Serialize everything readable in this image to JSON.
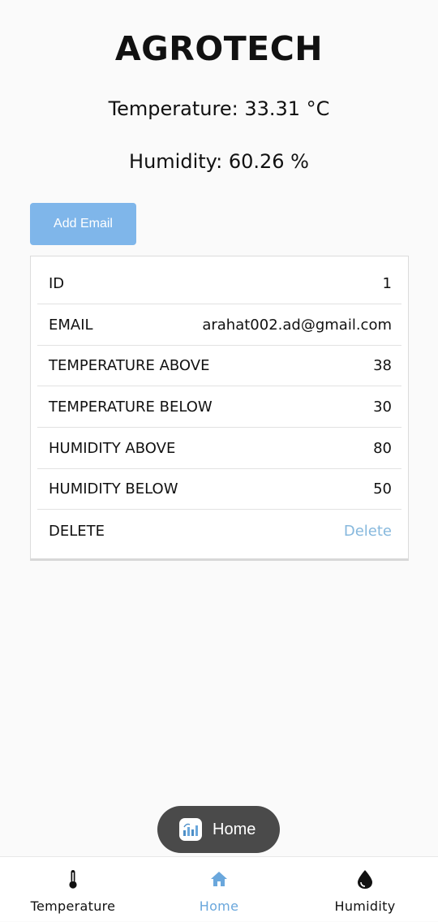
{
  "app": {
    "title": "AGROTECH",
    "temperature_reading": "Temperature: 33.31 °C",
    "humidity_reading": "Humidity: 60.26 %"
  },
  "actions": {
    "add_email_label": "Add Email"
  },
  "record": {
    "rows": [
      {
        "label": "ID",
        "value": "1"
      },
      {
        "label": "EMAIL",
        "value": "arahat002.ad@gmail.com"
      },
      {
        "label": "TEMPERATURE ABOVE",
        "value": "38"
      },
      {
        "label": "TEMPERATURE BELOW",
        "value": "30"
      },
      {
        "label": "HUMIDITY ABOVE",
        "value": "80"
      },
      {
        "label": "HUMIDITY BELOW",
        "value": "50"
      },
      {
        "label": "DELETE",
        "value": "Delete"
      }
    ]
  },
  "toast": {
    "label": "Home",
    "icon": "app-icon"
  },
  "nav": {
    "items": [
      {
        "label": "Temperature",
        "icon": "thermometer-icon"
      },
      {
        "label": "Home",
        "icon": "home-icon"
      },
      {
        "label": "Humidity",
        "icon": "water-drop-icon"
      }
    ],
    "active_color": "#6aa7dc",
    "inactive_color": "#111111"
  },
  "colors": {
    "button_bg": "#7fb6ea",
    "link": "#86b8dd",
    "toast_bg": "#4a4a4a"
  }
}
